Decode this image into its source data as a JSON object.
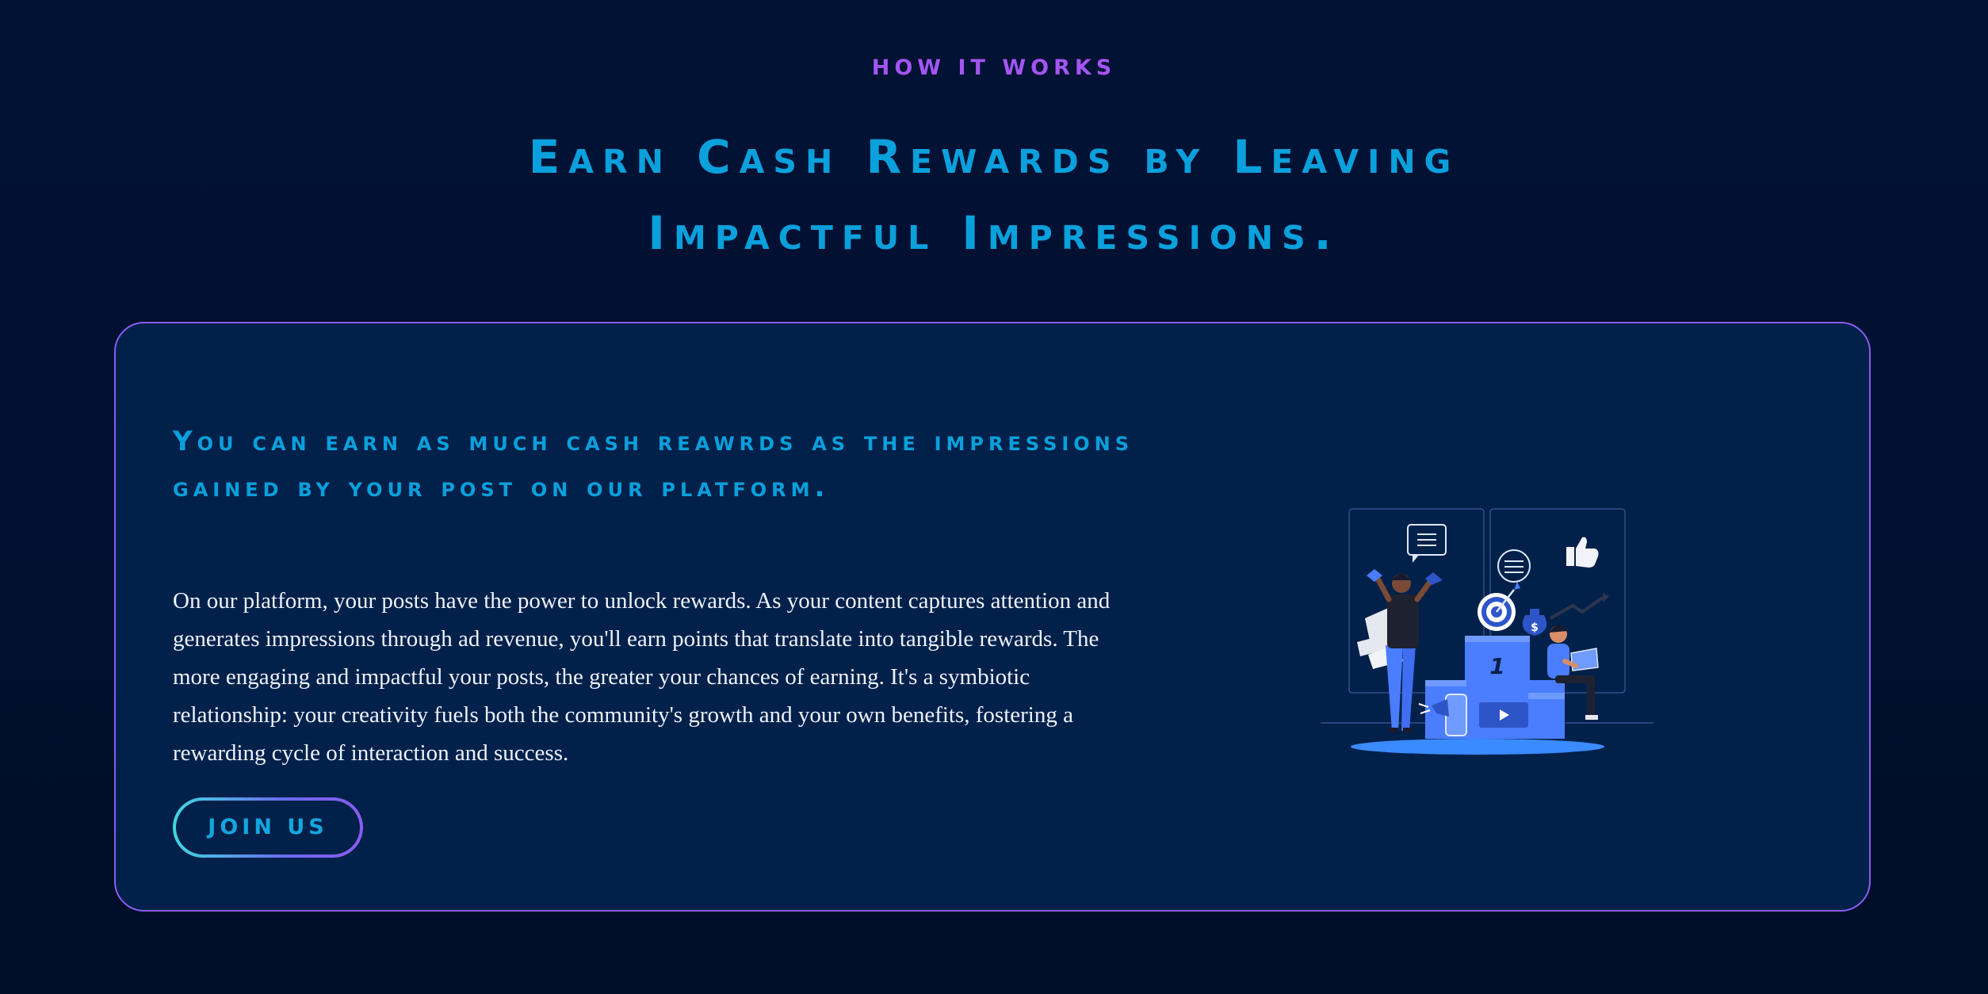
{
  "section": {
    "eyebrow": "HOW IT WORKS",
    "headline_line1": "Earn Cash Rewards by Leaving",
    "headline_line2": "Impactful Impressions."
  },
  "card": {
    "title": "You can earn as much cash reawrds as the impressions gained by your post on our platform.",
    "body": "On our platform, your posts have the power to unlock rewards. As your content captures attention and generates impressions through ad revenue, you'll earn points that translate into tangible rewards. The more engaging and impactful your posts, the greater your chances of earning. It's a symbiotic relationship: your creativity fuels both the community's growth and your own benefits, fostering a rewarding cycle of interaction and success.",
    "join_label": "JOIN US",
    "podium_number": "1"
  },
  "colors": {
    "background": "#011030",
    "card_background": "#02214a",
    "card_border": "#8a5cf0",
    "accent_blue": "#0aa0dc",
    "eyebrow_purple": "#a455f2",
    "illustration_blue": "#4a7dff"
  },
  "icons": {
    "illustration": "podium-winners-illustration",
    "chat": "chat-bubble-icon",
    "thumbs_up": "thumbs-up-icon",
    "target": "target-icon",
    "money_bag": "money-bag-icon",
    "play": "play-icon"
  }
}
